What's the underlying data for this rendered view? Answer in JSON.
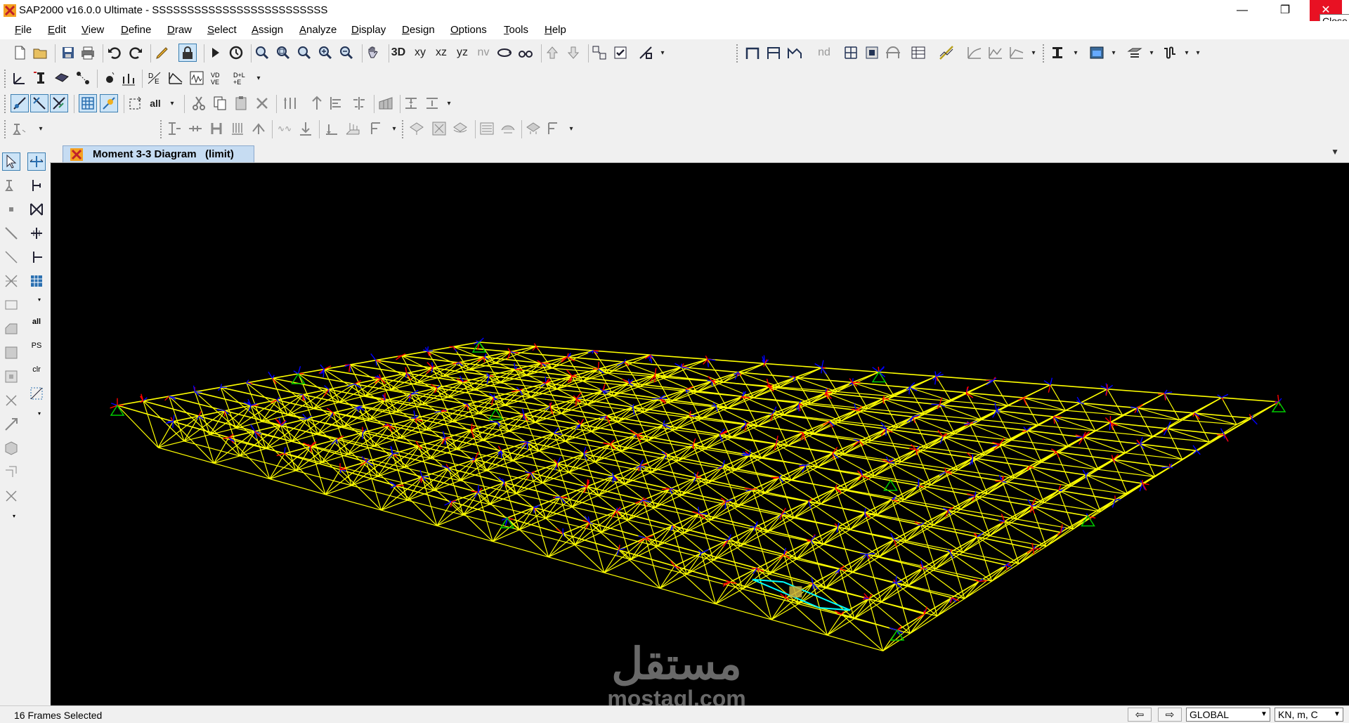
{
  "window": {
    "title": "SAP2000 v16.0.0 Ultimate  - SSSSSSSSSSSSSSSSSSSSSSSSS",
    "minimize_glyph": "—",
    "restore_glyph": "❐",
    "close_glyph": "✕",
    "close_tooltip": "Close"
  },
  "menu": {
    "items": [
      "File",
      "Edit",
      "View",
      "Define",
      "Draw",
      "Select",
      "Assign",
      "Analyze",
      "Display",
      "Design",
      "Options",
      "Tools",
      "Help"
    ]
  },
  "toolbar": {
    "view_xy": "xy",
    "view_xz": "xz",
    "view_yz": "yz",
    "view_nv": "nv",
    "view_3d": "3D",
    "label_nd": "nd",
    "label_all": "all"
  },
  "sidebar": {
    "label_all": "all",
    "label_ps": "PS",
    "label_clr": "clr"
  },
  "tab": {
    "label": "Moment 3-3 Diagram   (limit)",
    "dropdown_glyph": "▼"
  },
  "viewport": {
    "background": "#000000",
    "frame_color": "#ffff00",
    "moment_color_positive": "#ff0000",
    "moment_color_negative": "#0000ff",
    "support_color": "#00cc00",
    "selected_color": "#00ffff"
  },
  "watermark": {
    "arabic": "مستقل",
    "latin": "mostaql.com"
  },
  "status": {
    "selection_text": "16 Frames Selected",
    "nav_left": "⇦",
    "nav_right": "⇨",
    "coord_system": "GLOBAL",
    "units": "KN, m, C"
  }
}
